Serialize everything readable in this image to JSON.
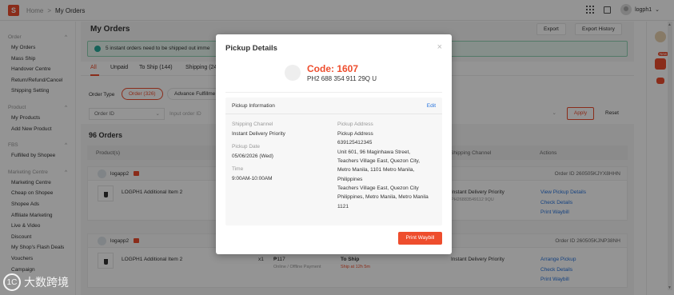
{
  "topbar": {
    "logo": "S",
    "breadcrumb_home": "Home",
    "breadcrumb_sep": ">",
    "breadcrumb_current": "My Orders",
    "username": "logph1",
    "username_caret": "⌄"
  },
  "sidebar": {
    "sections": [
      {
        "title": "Order",
        "items": [
          "My Orders",
          "Mass Ship",
          "Handover Centre",
          "Return/Refund/Cancel",
          "Shipping Setting"
        ]
      },
      {
        "title": "Product",
        "items": [
          "My Products",
          "Add New Product"
        ]
      },
      {
        "title": "FBS",
        "items": [
          "Fulfilled by Shopee"
        ]
      },
      {
        "title": "Marketing Centre",
        "items": [
          "Marketing Centre",
          "Cheap on Shopee",
          "Shopee Ads",
          "Affiliate Marketing",
          "Live & Video",
          "Discount",
          "My Shop's Flash Deals",
          "Vouchers",
          "Campaign"
        ]
      }
    ],
    "chevron": "^"
  },
  "header": {
    "title": "My Orders",
    "export_label": "Export",
    "export_history_label": "Export History"
  },
  "banner": {
    "text": "5 instant orders need to be shipped out imme"
  },
  "tabs": [
    "All",
    "Unpaid",
    "To Ship (144)",
    "Shipping (24"
  ],
  "filter": {
    "order_type_label": "Order Type",
    "chip_order": "Order (326)",
    "chip_advance": "Advance Fulfillme",
    "search_field": "Order ID",
    "search_placeholder": "Input order ID",
    "caret": "⌄",
    "apply_label": "Apply",
    "reset_label": "Reset"
  },
  "orders_count": "96 Orders",
  "table": {
    "headers": {
      "product": "Product(s)",
      "shipping_channel": "Shipping Channel",
      "actions": "Actions"
    },
    "orders": [
      {
        "buyer": "logapp2",
        "order_id": "Order ID 260505KJYX8HHN",
        "product": "LOGPH1 Additional Item 2",
        "shipping": "Instant Delivery Priority",
        "shipping_sub": "PH26883549112 9QU",
        "actions": [
          "View Pickup Details",
          "Check Details",
          "Print Waybill"
        ]
      },
      {
        "buyer": "logapp2",
        "order_id": "Order ID 260505KJNP38NH",
        "product": "LOGPH1 Additional Item 2",
        "qty": "x1",
        "price": "₱117",
        "payment": "Online / Offline Payment",
        "status": "To Ship",
        "status_sub": "Ship at 12h 5m",
        "shipping": "Instant Delivery Priority",
        "actions": [
          "Arrange Pickup",
          "Check Details",
          "Print Waybill"
        ]
      }
    ]
  },
  "rail": {
    "new_badge": "New"
  },
  "scroll": {
    "up": "▲",
    "down": "▼"
  },
  "modal": {
    "title": "Pickup Details",
    "close": "×",
    "code": "Code: 1607",
    "tracking": "PH2 688 354 911 29Q U",
    "info_title": "Pickup Information",
    "edit_label": "Edit",
    "shipping_channel_label": "Shipping Channel",
    "shipping_channel_value": "Instant Delivery Priority",
    "pickup_date_label": "Pickup Date",
    "pickup_date_value": "05/06/2026 (Wed)",
    "time_label": "Time",
    "time_value": "9:00AM-10:00AM",
    "pickup_address_label": "Pickup Address",
    "address_lines": [
      "Pickup Address",
      "639125412345",
      "Unit 601, 96 Maginhawa Street,",
      "Teachers Village East, Quezon City,",
      "Metro Manila, 1101 Metro Manila,",
      "Philippines",
      "Teachers Village East, Quezon City",
      "Philippines, Metro Manila, Metro Manila",
      "1121"
    ],
    "print_label": "Print Waybill"
  },
  "watermark": {
    "badge": "1C",
    "text": "大数跨境"
  },
  "colors": {
    "brand": "#ee4d2d",
    "link": "#2673dd"
  }
}
